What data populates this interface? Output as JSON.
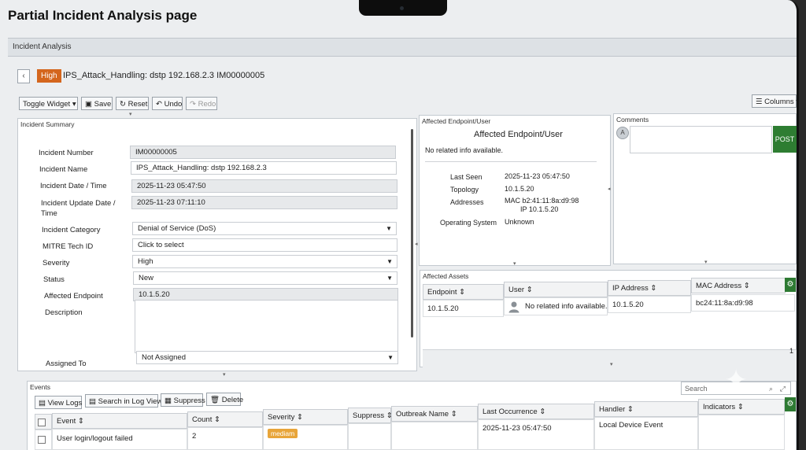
{
  "page_title": "Partial Incident Analysis page",
  "bar_title": "Incident Analysis",
  "incident": {
    "severity": "High",
    "title": "IPS_Attack_Handling: dstp 192.168.2.3 IM00000005"
  },
  "toolbar": {
    "toggle_widget": "Toggle Widget ▾",
    "save": "Save",
    "reset": "Reset",
    "undo": "Undo",
    "redo": "Redo",
    "columns": "Columns ▾"
  },
  "summary": {
    "title": "Incident Summary",
    "fields": {
      "number_label": "Incident Number",
      "number": "IM00000005",
      "name_label": "Incident Name",
      "name": "IPS_Attack_Handling: dstp 192.168.2.3",
      "date_label": "Incident Date / Time",
      "date": "2025-11-23 05:47:50",
      "update_label_1": "Incident Update Date /",
      "update_label_2": "Time",
      "update": "2025-11-23 07:11:10",
      "category_label": "Incident Category",
      "category": "Denial of Service (DoS)",
      "mitre_label": "MITRE Tech ID",
      "mitre": "Click to select",
      "severity_label": "Severity",
      "severity": "High",
      "status_label": "Status",
      "status": "New",
      "endpoint_label": "Affected Endpoint",
      "endpoint": "10.1.5.20",
      "description_label": "Description",
      "assigned_label": "Assigned To",
      "assigned": "Not Assigned"
    }
  },
  "endpoint": {
    "title": "Affected Endpoint/User",
    "heading": "Affected Endpoint/User",
    "no_info": "No related info available.",
    "last_seen_label": "Last Seen",
    "last_seen": "2025-11-23 05:47:50",
    "topology_label": "Topology",
    "topology": "10.1.5.20",
    "addresses_label": "Addresses",
    "mac": "MAC b2:41:11:8a:d9:98",
    "ip": "IP 10.1.5.20",
    "os_label": "Operating System",
    "os": "Unknown"
  },
  "comments": {
    "title": "Comments",
    "avatar": "A",
    "post": "POST"
  },
  "assets": {
    "title": "Affected Assets",
    "headers": [
      "Endpoint ⇕",
      "User ⇕",
      "IP Address ⇕",
      "MAC Address ⇕"
    ],
    "row": {
      "endpoint": "10.1.5.20",
      "user": "No related info available.",
      "ip": "10.1.5.20",
      "mac": "bc24:11:8a:d9:98"
    },
    "count": "1"
  },
  "events": {
    "title": "Events",
    "buttons": {
      "view_logs": "View Logs",
      "search_log": "Search in Log View",
      "suppress": "Suppress",
      "delete": "Delete"
    },
    "search_placeholder": "Search",
    "headers": [
      "Event ⇕",
      "Count ⇕",
      "Severity ⇕",
      "Suppress ⇕",
      "Outbreak Name ⇕",
      "Last Occurrence ⇕",
      "Handler ⇕",
      "Indicators ⇕"
    ],
    "row": {
      "event": "User login/logout failed",
      "count": "2",
      "severity": "mediam",
      "last": "2025-11-23 05:47:50",
      "handler": "Local Device Event"
    }
  }
}
